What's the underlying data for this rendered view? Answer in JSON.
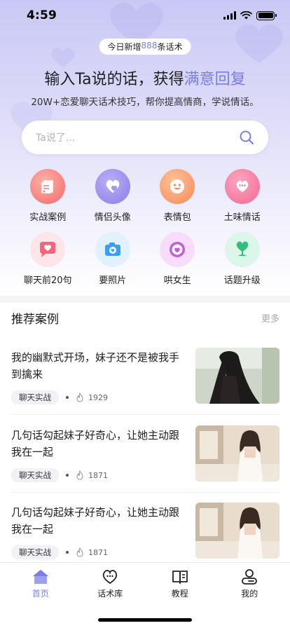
{
  "status": {
    "time": "4:59"
  },
  "banner": {
    "prefix": "今日新增",
    "count": "888",
    "suffix": "条话术"
  },
  "headline": {
    "main": "输入Ta说的话，获得",
    "accent": "满意回复"
  },
  "subline": "20W+恋爱聊天话术技巧，帮你提高情商，学说情话。",
  "search": {
    "placeholder": "Ta说了..."
  },
  "grid": [
    {
      "label": "实战案例",
      "icon": "case-icon"
    },
    {
      "label": "情侣头像",
      "icon": "couple-avatar-icon"
    },
    {
      "label": "表情包",
      "icon": "emoji-icon"
    },
    {
      "label": "土味情话",
      "icon": "chat-bubble-icon"
    },
    {
      "label": "聊天前20句",
      "icon": "heart-chat-icon"
    },
    {
      "label": "要照片",
      "icon": "camera-icon"
    },
    {
      "label": "哄女生",
      "icon": "heart-target-icon"
    },
    {
      "label": "话题升级",
      "icon": "plant-icon"
    }
  ],
  "section": {
    "title": "推荐案例",
    "more": "更多"
  },
  "cards": [
    {
      "title": "我的幽默式开场，妹子还不是被我手到擒来",
      "tag": "聊天实战",
      "count": "1929"
    },
    {
      "title": "几句话勾起妹子好奇心，让她主动跟我在一起",
      "tag": "聊天实战",
      "count": "1871"
    },
    {
      "title": "几句话勾起妹子好奇心，让她主动跟我在一起",
      "tag": "聊天实战",
      "count": "1871"
    }
  ],
  "tabs": [
    {
      "label": "首页",
      "icon": "home-icon",
      "active": true
    },
    {
      "label": "话术库",
      "icon": "heart-chat-tab-icon",
      "active": false
    },
    {
      "label": "教程",
      "icon": "book-icon",
      "active": false
    },
    {
      "label": "我的",
      "icon": "profile-icon",
      "active": false
    }
  ],
  "colors": {
    "accent": "#7b7de8",
    "hero_top": "#c9c8f5"
  }
}
